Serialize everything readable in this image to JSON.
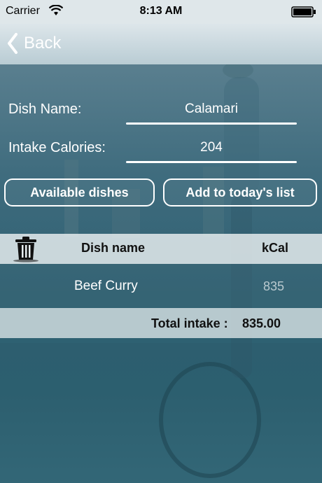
{
  "status_bar": {
    "carrier": "Carrier",
    "time": "8:13 AM"
  },
  "nav": {
    "back_label": "Back"
  },
  "form": {
    "dish_name_label": "Dish Name:",
    "dish_name_value": "Calamari",
    "intake_label": "Intake Calories:",
    "intake_value": "204"
  },
  "buttons": {
    "available_dishes": "Available dishes",
    "add_to_list": "Add to today's list"
  },
  "table": {
    "headers": {
      "dish": "Dish name",
      "kcal": "kCal"
    },
    "rows": [
      {
        "dish": "Beef Curry",
        "kcal": "835"
      }
    ],
    "total_label": "Total intake :",
    "total_value": "835.00"
  },
  "icons": {
    "wifi": "wifi-icon",
    "battery": "battery-icon",
    "back": "chevron-left-icon",
    "trash": "trash-icon"
  },
  "colors": {
    "header_bg": "#dde6ea",
    "accent": "#ffffff"
  }
}
